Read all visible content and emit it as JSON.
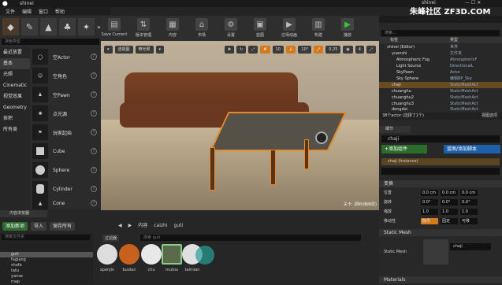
{
  "titlebar": {
    "title": "shinei",
    "project": "shinei"
  },
  "menu": [
    "文件",
    "编辑",
    "窗口",
    "帮助"
  ],
  "modes_panel": {
    "search_placeholder": "搜索类型"
  },
  "categories": [
    "最近放置",
    "基本",
    "光照",
    "Cinematic",
    "视觉效果",
    "Geometry",
    "体积",
    "所有类"
  ],
  "place_items": [
    {
      "label": "空Actor",
      "icon": "empty-actor-icon"
    },
    {
      "label": "空角色",
      "icon": "empty-character-icon"
    },
    {
      "label": "空Pawn",
      "icon": "empty-pawn-icon"
    },
    {
      "label": "点光源",
      "icon": "point-light-icon"
    },
    {
      "label": "玩家起始",
      "icon": "player-start-icon"
    },
    {
      "label": "Cube",
      "icon": "cube-icon"
    },
    {
      "label": "Sphere",
      "icon": "sphere-icon"
    },
    {
      "label": "Cylinder",
      "icon": "cylinder-icon"
    },
    {
      "label": "Cone",
      "icon": "cone-icon"
    }
  ],
  "toolbar": [
    {
      "label": "Save Current",
      "icon": "save-icon"
    },
    {
      "label": "版本管理",
      "icon": "source-control-icon"
    },
    {
      "label": "内容",
      "icon": "content-icon"
    },
    {
      "label": "市场",
      "icon": "marketplace-icon"
    },
    {
      "label": "设置",
      "icon": "settings-icon"
    },
    {
      "label": "蓝图",
      "icon": "blueprint-icon"
    },
    {
      "label": "过场动画",
      "icon": "cinematics-icon"
    },
    {
      "label": "构建",
      "icon": "build-icon"
    },
    {
      "label": "播放",
      "icon": "play-icon"
    }
  ],
  "viewport": {
    "view_mode": "透视图",
    "lighting": "带光照",
    "snap_values": [
      "10",
      "10°",
      "0.25",
      "4"
    ],
    "level_label": "关卡: 调制(继续层)"
  },
  "outliner": {
    "search_placeholder": "搜索...",
    "col_label": "标签",
    "col_type": "类型",
    "rows": [
      {
        "name": "shinei (Editor)",
        "type": "世界"
      },
      {
        "name": "yuanshi",
        "type": "文件夹"
      },
      {
        "name": "Atmospheric Fog",
        "type": "AtmosphericF"
      },
      {
        "name": "Light Source",
        "type": "DirectionalL"
      },
      {
        "name": "SkyPawn",
        "type": "Actor"
      },
      {
        "name": "Sky Sphere",
        "type": "编辑BP_Sky"
      },
      {
        "name": "chaji",
        "type": "StaticMeshAct"
      },
      {
        "name": "chuanghu",
        "type": "StaticMeshAct"
      },
      {
        "name": "chuanghu2",
        "type": "StaticMeshAct"
      },
      {
        "name": "chuanghu3",
        "type": "StaticMeshAct"
      },
      {
        "name": "dengdai",
        "type": "StaticMeshAct"
      }
    ],
    "selected_index": 6,
    "actor_count": "38个actor (选择了1个)",
    "view_options": "视图选项"
  },
  "details": {
    "tab": "细节",
    "name": "chaji",
    "add_component": "+添加组件",
    "blueprint_button": "蓝图/添加脚本",
    "instance": "chaji (Instance)",
    "transform_section": "变换",
    "location_label": "位置",
    "rotation_label": "旋转",
    "scale_label": "缩放",
    "mobility_label": "移动性",
    "location": [
      "0.0 cm",
      "0.0 cm",
      "0.0 cm"
    ],
    "rotation": [
      "0.0°",
      "0.0°",
      "0.0°"
    ],
    "scale": [
      "1.0",
      "1.0",
      "1.0"
    ],
    "mobility": [
      "静态",
      "固定",
      "可移"
    ],
    "static_mesh_section": "Static Mesh",
    "static_mesh_label": "Static Mesh",
    "static_mesh_value": "chaji",
    "materials_section": "Materials"
  },
  "content_browser": {
    "tab": "内容浏览器",
    "add_new": "添加新项",
    "import": "导入",
    "save_all": "保存所有",
    "breadcrumbs": [
      "内容",
      "caizhi",
      "guti"
    ],
    "folder_search": "搜索文件夹",
    "filter_label": "过滤器",
    "asset_search": "搜索 guti",
    "folders": [
      "guti",
      "fagiang",
      "shafa",
      "tatu",
      "yanse",
      "map"
    ],
    "selected_folder": 0,
    "assets": [
      {
        "label": "xpenjin",
        "color": "#ddd"
      },
      {
        "label": "buolan",
        "color": "#c8601e"
      },
      {
        "label": "chu",
        "color": "#e8e8e8"
      },
      {
        "label": "mutou",
        "color": "#5a6a4a"
      },
      {
        "label": "talmian",
        "color": "#e0e0e0"
      }
    ]
  },
  "watermark": "朱峰社区 ZF3D.COM"
}
